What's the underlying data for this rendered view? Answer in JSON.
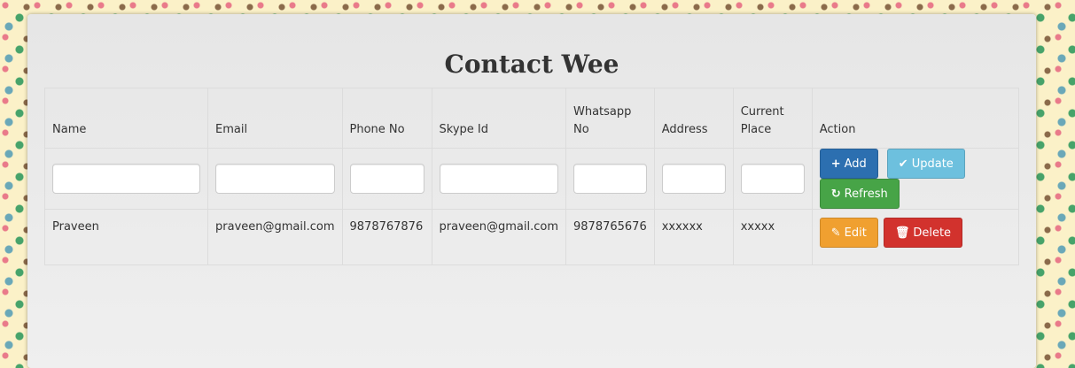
{
  "app": {
    "title": "Contact Wee"
  },
  "table": {
    "headers": [
      "Name",
      "Email",
      "Phone No",
      "Skype Id",
      "Whatsapp No",
      "Address",
      "Current Place",
      "Action"
    ],
    "row": {
      "name": "Praveen",
      "email": "praveen@gmail.com",
      "phone": "9878767876",
      "skype": "praveen@gmail.com",
      "whatsapp": "9878765676",
      "address": "xxxxxx",
      "current_place": "xxxxx"
    }
  },
  "buttons": {
    "add": "Add",
    "update": "Update",
    "refresh": "Refresh",
    "edit": "Edit",
    "delete": "Delete"
  },
  "icons": {
    "add": "plus-icon",
    "update": "check-icon",
    "refresh": "refresh-icon",
    "edit": "pencil-icon",
    "delete": "trash-icon"
  },
  "colors": {
    "add": "#2c6fb0",
    "update": "#6dc0de",
    "refresh": "#47a447",
    "edit": "#f0a030",
    "delete": "#d2322d"
  }
}
